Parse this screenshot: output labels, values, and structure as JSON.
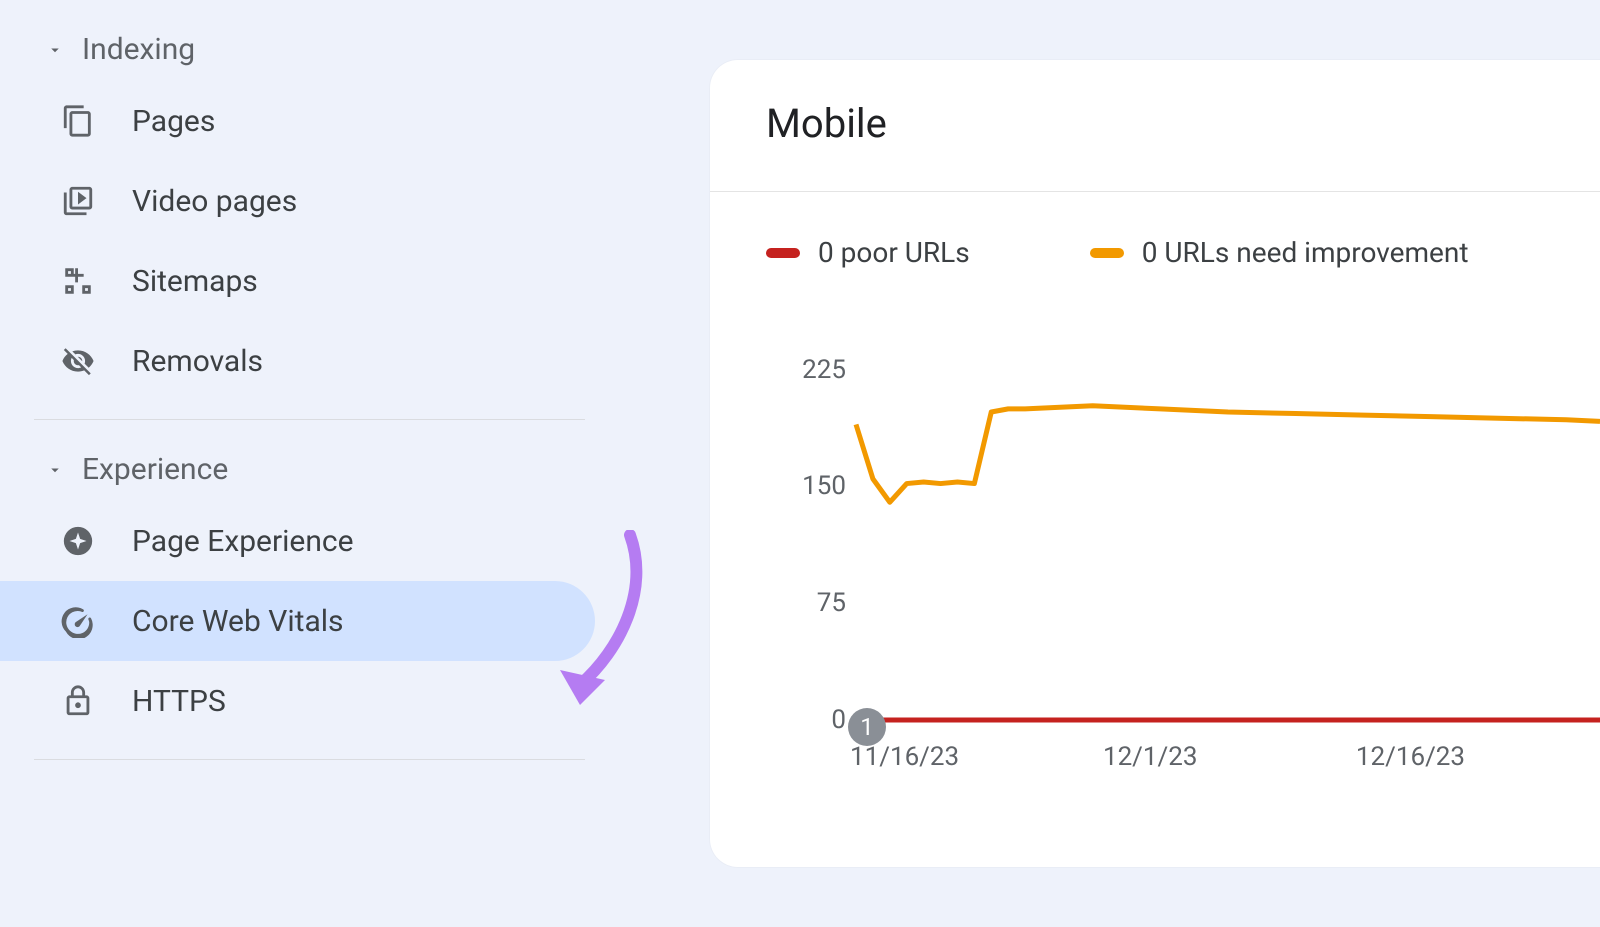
{
  "sidebar": {
    "sections": [
      {
        "label": "Indexing",
        "items": [
          {
            "label": "Pages",
            "icon": "pages"
          },
          {
            "label": "Video pages",
            "icon": "video"
          },
          {
            "label": "Sitemaps",
            "icon": "sitemaps"
          },
          {
            "label": "Removals",
            "icon": "removals"
          }
        ]
      },
      {
        "label": "Experience",
        "items": [
          {
            "label": "Page Experience",
            "icon": "sparkle"
          },
          {
            "label": "Core Web Vitals",
            "icon": "speed",
            "selected": true
          },
          {
            "label": "HTTPS",
            "icon": "lock"
          }
        ]
      }
    ]
  },
  "card": {
    "title": "Mobile",
    "legend": [
      {
        "color": "#c5221f",
        "text": "0 poor URLs"
      },
      {
        "color": "#f29900",
        "text": "0 URLs need improvement"
      }
    ],
    "event_badge": "1"
  },
  "chart_data": {
    "type": "line",
    "title": "Mobile",
    "xlabel": "",
    "ylabel": "",
    "ylim": [
      0,
      225
    ],
    "y_ticks": [
      0,
      75,
      150,
      225
    ],
    "x_ticks": [
      "11/16/23",
      "12/1/23",
      "12/16/23"
    ],
    "series": [
      {
        "name": "0 poor URLs",
        "color": "#c5221f",
        "x": [
          0,
          7,
          22,
          37,
          44
        ],
        "values": [
          0,
          0,
          0,
          0,
          0
        ]
      },
      {
        "name": "0 URLs need improvement",
        "color": "#f29900",
        "x": [
          0,
          1,
          2,
          3,
          4,
          5,
          6,
          7,
          8,
          9,
          10,
          14,
          18,
          22,
          26,
          30,
          34,
          38,
          42,
          44
        ],
        "values": [
          190,
          155,
          140,
          152,
          153,
          152,
          153,
          152,
          198,
          200,
          200,
          202,
          200,
          198,
          197,
          196,
          195,
          194,
          193,
          192
        ]
      }
    ],
    "x_domain": [
      0,
      44
    ]
  }
}
